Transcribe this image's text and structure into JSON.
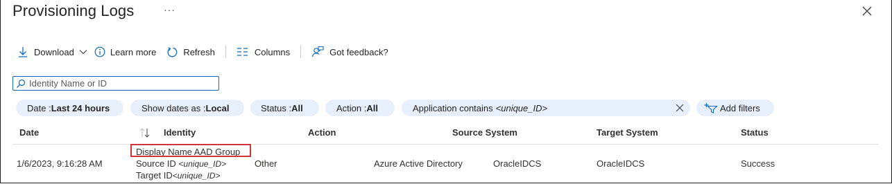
{
  "title": "Provisioning Logs",
  "title_more": "···",
  "toolbar": {
    "download": "Download",
    "learn_more": "Learn more",
    "refresh": "Refresh",
    "columns": "Columns",
    "feedback": "Got feedback?"
  },
  "search": {
    "value": "",
    "placeholder": "Identity Name or ID"
  },
  "filters": {
    "date": {
      "key": "Date : ",
      "value": "Last 24 hours"
    },
    "show_dates": {
      "key": "Show dates as : ",
      "value": "Local"
    },
    "status": {
      "key": "Status : ",
      "value": "All"
    },
    "action": {
      "key": "Action : ",
      "value": "All"
    },
    "application": {
      "key": "Application contains ",
      "value": "<unique_ID>"
    },
    "add_filters": "Add filters"
  },
  "columns": [
    "Date",
    "Identity",
    "Action",
    "Source System",
    "Target System",
    "Status"
  ],
  "rows": [
    {
      "date": "1/6/2023, 9:16:28 AM",
      "identity_display": "Display Name AAD Group",
      "source_id_label": "Source ID ",
      "source_id_value": "<unique_ID>",
      "target_id_label": "Target ID",
      "target_id_value": "<unique_ID>",
      "action": "Other",
      "source_system": "Azure Active Directory",
      "source_app": "OracleIDCS",
      "target_system": "OracleIDCS",
      "status": "Success"
    }
  ],
  "colors": {
    "accent": "#0f6cbd",
    "pill_bg": "#e7f0fa",
    "highlight": "#d13438"
  }
}
